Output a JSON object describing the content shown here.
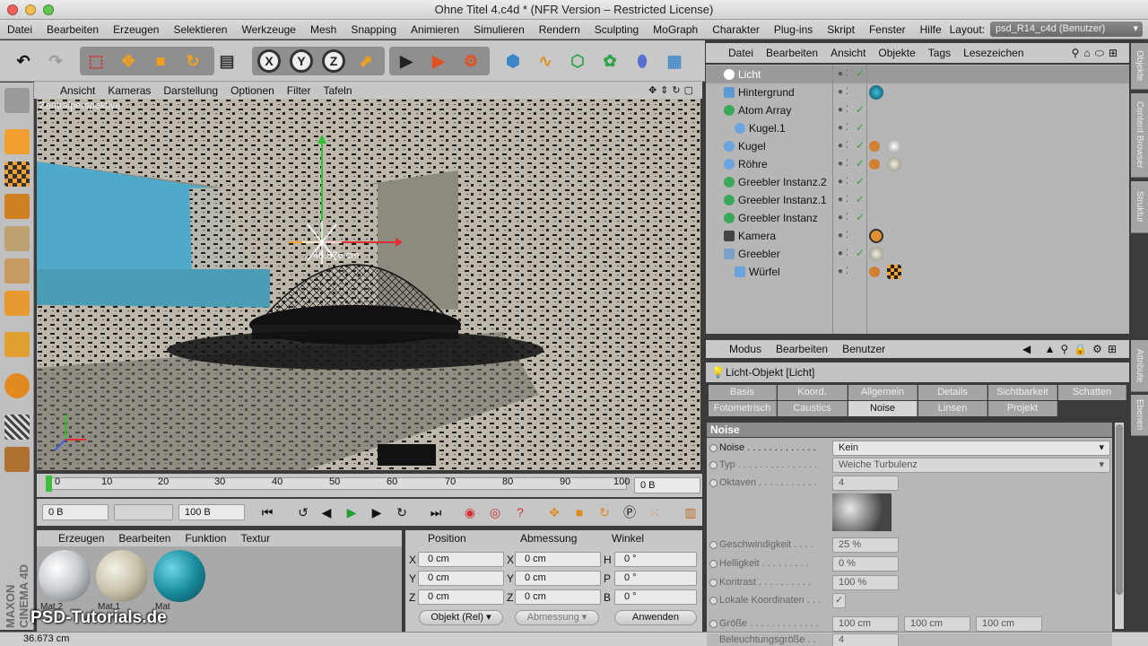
{
  "window": {
    "title": "Ohne Titel 4.c4d * (NFR Version – Restricted License)"
  },
  "menubar": {
    "items": [
      "Datei",
      "Bearbeiten",
      "Erzeugen",
      "Selektieren",
      "Werkzeuge",
      "Mesh",
      "Snapping",
      "Animieren",
      "Simulieren",
      "Rendern",
      "Sculpting",
      "MoGraph",
      "Charakter",
      "Plug-ins",
      "Skript",
      "Fenster",
      "Hilfe"
    ],
    "layout_label": "Layout:",
    "layout_value": "psd_R14_c4d (Benutzer)"
  },
  "viewport": {
    "menu": [
      "Ansicht",
      "Kameras",
      "Darstellung",
      "Optionen",
      "Filter",
      "Tafeln"
    ],
    "camera_label": "Zentralperspektive",
    "measure_label": "46.576 cm"
  },
  "timeline": {
    "ticks": [
      "0",
      "10",
      "20",
      "30",
      "40",
      "50",
      "60",
      "70",
      "80",
      "90",
      "100"
    ],
    "current_frame": "0 B",
    "start_field": "0 B",
    "end_field": "100 B"
  },
  "materials": {
    "menu": [
      "Erzeugen",
      "Bearbeiten",
      "Funktion",
      "Textur"
    ],
    "items": [
      {
        "label": "Mat.2",
        "color": "#d8dde0"
      },
      {
        "label": "Mat.1",
        "color": "#d2cdb8"
      },
      {
        "label": "Mat",
        "color": "#1a8fa0"
      }
    ]
  },
  "coordinates": {
    "headers": [
      "Position",
      "Abmessung",
      "Winkel"
    ],
    "rows": [
      {
        "axis1": "X",
        "pos": "0 cm",
        "axis2": "X",
        "size": "0 cm",
        "axis3": "H",
        "rot": "0 °"
      },
      {
        "axis1": "Y",
        "pos": "0 cm",
        "axis2": "Y",
        "size": "0 cm",
        "axis3": "P",
        "rot": "0 °"
      },
      {
        "axis1": "Z",
        "pos": "0 cm",
        "axis2": "Z",
        "size": "0 cm",
        "axis3": "B",
        "rot": "0 °"
      }
    ],
    "mode_select": "Objekt (Rel)",
    "size_select": "Abmessung",
    "apply_button": "Anwenden"
  },
  "status": {
    "text": "36.673 cm"
  },
  "watermark": "PSD-Tutorials.de",
  "maxon_logo": "MAXON CINEMA 4D",
  "object_manager": {
    "menu": [
      "Datei",
      "Bearbeiten",
      "Ansicht",
      "Objekte",
      "Tags",
      "Lesezeichen"
    ],
    "objects": [
      {
        "name": "Licht",
        "indent": 0,
        "selected": true
      },
      {
        "name": "Hintergrund",
        "indent": 0
      },
      {
        "name": "Atom Array",
        "indent": 0
      },
      {
        "name": "Kugel.1",
        "indent": 1
      },
      {
        "name": "Kugel",
        "indent": 0
      },
      {
        "name": "Röhre",
        "indent": 0
      },
      {
        "name": "Greebler Instanz.2",
        "indent": 0
      },
      {
        "name": "Greebler Instanz.1",
        "indent": 0
      },
      {
        "name": "Greebler Instanz",
        "indent": 0
      },
      {
        "name": "Kamera",
        "indent": 0
      },
      {
        "name": "Greebler",
        "indent": 0
      },
      {
        "name": "Würfel",
        "indent": 1
      }
    ]
  },
  "right_tabs": [
    "Objekte",
    "Content Browser",
    "Struktur",
    "Attribute",
    "Ebenen"
  ],
  "attribute_manager": {
    "menu": [
      "Modus",
      "Bearbeiten",
      "Benutzer"
    ],
    "title": "Licht-Objekt [Licht]",
    "tabs_row1": [
      "Basis",
      "Koord.",
      "Allgemein",
      "Details",
      "Sichtbarkeit",
      "Schatten"
    ],
    "tabs_row2": [
      "Fotometrisch",
      "Caustics",
      "Noise",
      "Linsen",
      "Projekt"
    ],
    "active_tab": "Noise",
    "section": "Noise",
    "params": [
      {
        "label": "Noise . . . . . . . . . . . . .",
        "value": "Kein"
      },
      {
        "label": "Typ . . . . . . . . . . . . . . .",
        "value": "Weiche Turbulenz"
      },
      {
        "label": "Oktaven . . . . . . . . . . .",
        "value": "4"
      },
      {
        "label": "Geschwindigkeit . . . .",
        "value": "25 %"
      },
      {
        "label": "Helligkeit . . . . . . . . .",
        "value": "0 %"
      },
      {
        "label": "Kontrast . . . . . . . . . .",
        "value": "100 %"
      },
      {
        "label": "Lokale Koordinaten . . .",
        "value": "✓"
      },
      {
        "label": "Größe . . . . . . . . . . . . .",
        "value": "100 cm",
        "value2": "100 cm",
        "value3": "100 cm"
      },
      {
        "label": "Beleuchtungsgröße . .",
        "value": "4"
      }
    ]
  }
}
